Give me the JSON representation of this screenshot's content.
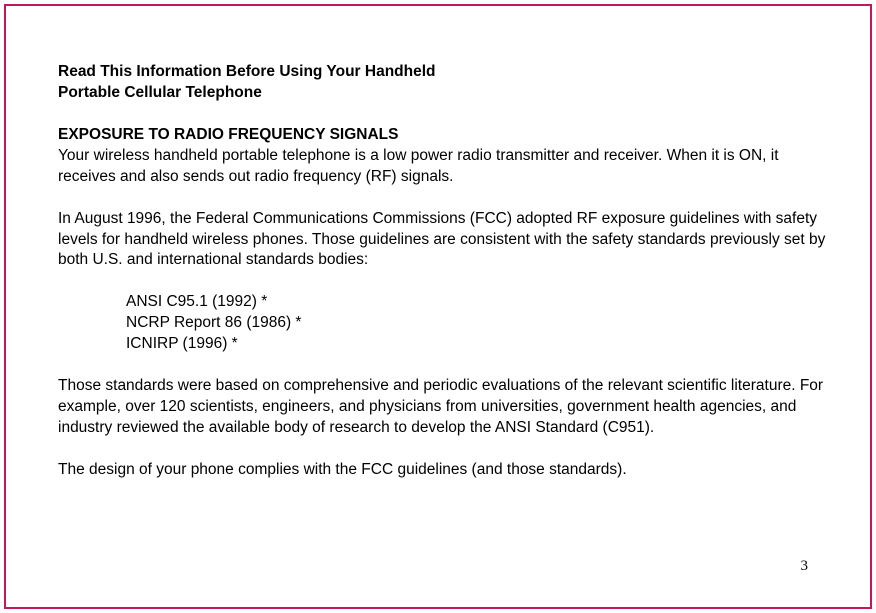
{
  "title_line1": "Read This Information Before Using Your Handheld",
  "title_line2": "Portable Cellular Telephone",
  "section_heading": "EXPOSURE TO RADIO FREQUENCY  SIGNALS",
  "para1": "Your wireless handheld portable telephone is a low power radio transmitter and receiver. When it is ON, it receives and also sends out radio frequency (RF) signals.",
  "para2": "In August 1996, the Federal Communications Commissions (FCC) adopted RF exposure guidelines with safety levels for handheld wireless phones. Those guidelines  are  consistent with the safety  standards previously set by both U.S. and international standards bodies:",
  "standards": [
    "ANSI C95.1 (1992) *",
    "NCRP Report 86 (1986) *",
    "ICNIRP (1996) *"
  ],
  "para3": "Those standards were based on comprehensive and periodic evaluations of the relevant scientific literature. For example, over 120 scientists, engineers, and physicians from universities, government health agencies, and industry reviewed the available body of research to develop the ANSI Standard (C951).",
  "para4": "The design of your phone complies with the FCC guidelines (and those standards).",
  "page_number": "3"
}
